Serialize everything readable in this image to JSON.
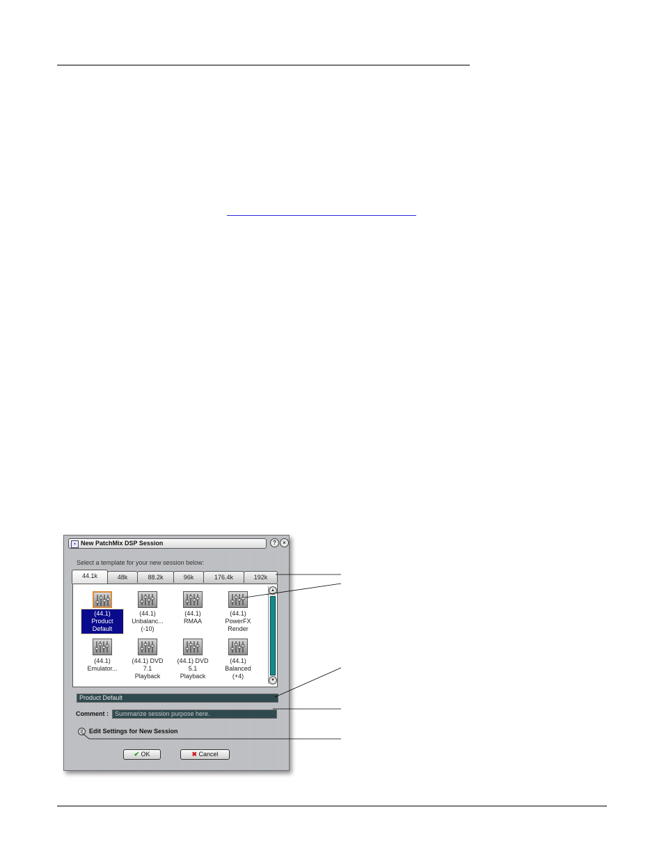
{
  "dialog": {
    "title": "New PatchMix DSP Session",
    "system_icon": "window-icon",
    "help_button": "?",
    "close_button": "×",
    "instruction": "Select a template for your new session below:",
    "tabs": [
      "44.1k",
      "48k",
      "88.2k",
      "96k",
      "176.4k",
      "192k"
    ],
    "active_tab": "44.1k",
    "templates": [
      {
        "lines": [
          "(44.1)",
          "Product",
          "Default"
        ],
        "selected": true
      },
      {
        "lines": [
          "(44.1)",
          "Unbalanc...",
          "(-10)"
        ],
        "selected": false
      },
      {
        "lines": [
          "(44.1)",
          "RMAA"
        ],
        "selected": false
      },
      {
        "lines": [
          "(44.1)",
          "PowerFX",
          "Render"
        ],
        "selected": false
      },
      {
        "lines": [
          "(44.1)",
          "Emulator..."
        ],
        "selected": false
      },
      {
        "lines": [
          "(44.1) DVD",
          "7.1",
          "Playback"
        ],
        "selected": false
      },
      {
        "lines": [
          "(44.1) DVD",
          "5.1",
          "Playback"
        ],
        "selected": false
      },
      {
        "lines": [
          "(44.1)",
          "Balanced",
          "(+4)"
        ],
        "selected": false
      }
    ],
    "session_name_value": "Product Default",
    "comment_label": "Comment :",
    "comment_placeholder": "Summarize session purpose here.",
    "edit_settings_label": "Edit Settings for New Session",
    "ok_label": "OK",
    "cancel_label": "Cancel"
  },
  "colors": {
    "selection": "#0a0a8c",
    "selected_icon_border": "#d78a3c",
    "scroll_thumb": "#158a8a",
    "field_background": "#2f4a4e",
    "ok_check": "#1d9a1d",
    "cancel_x": "#cc1a1a"
  }
}
